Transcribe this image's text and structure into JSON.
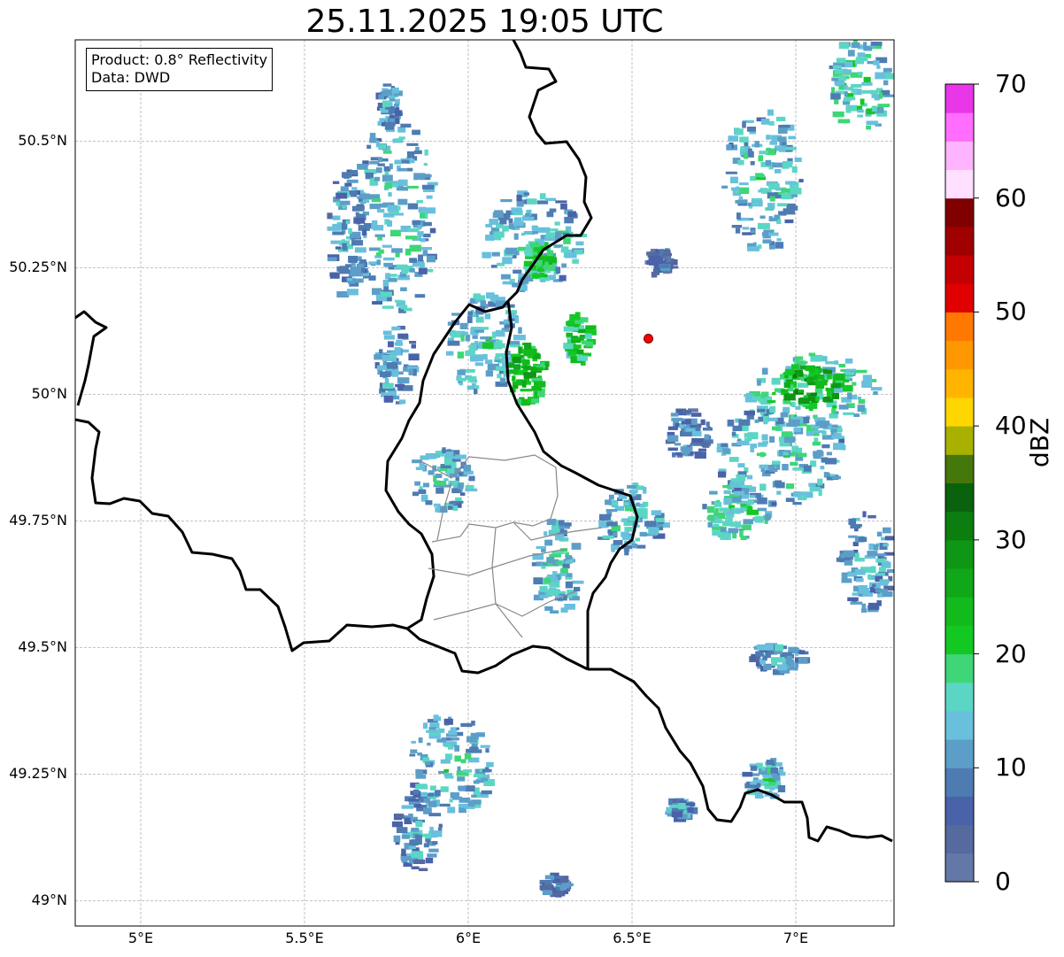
{
  "title": "25.11.2025 19:05 UTC",
  "info_box": {
    "product": "Product: 0.8° Reflectivity",
    "data": "Data: DWD"
  },
  "map_axes": {
    "lon_range": [
      4.8,
      7.3
    ],
    "lat_range": [
      48.95,
      50.7
    ],
    "x_ticks": [
      "5°E",
      "5.5°E",
      "6°E",
      "6.5°E",
      "7°E"
    ],
    "y_ticks": [
      "49°N",
      "49.25°N",
      "49.5°N",
      "49.75°N",
      "50°N",
      "50.25°N",
      "50.5°N"
    ],
    "gridlines": true
  },
  "radar_site_marker": {
    "lon": 6.55,
    "lat": 50.11,
    "color": "#ff0000"
  },
  "colorbar": {
    "label": "dBZ",
    "min": 0,
    "max": 70,
    "tick_labels": [
      "0",
      "10",
      "20",
      "30",
      "40",
      "50",
      "60",
      "70"
    ],
    "colors": [
      "#6478a8",
      "#566aa0",
      "#4a62a8",
      "#4e7bb2",
      "#5c9ec8",
      "#68c0dc",
      "#5cd6c4",
      "#3ed676",
      "#14c824",
      "#12ba1c",
      "#10a818",
      "#0e9614",
      "#0c7e10",
      "#0a620c",
      "#44780a",
      "#a8b000",
      "#ffd600",
      "#ffb400",
      "#ff9800",
      "#ff7800",
      "#e00000",
      "#c40000",
      "#a00000",
      "#800000",
      "#ffe0ff",
      "#ffb4ff",
      "#ff6eff",
      "#e836e8"
    ]
  },
  "echo_regions": [
    {
      "lon": 5.78,
      "lat": 50.35,
      "dlon": 0.12,
      "dlat": 0.2,
      "level": 6
    },
    {
      "lon": 5.63,
      "lat": 50.32,
      "dlon": 0.06,
      "dlat": 0.13,
      "level": 5
    },
    {
      "lon": 5.76,
      "lat": 50.57,
      "dlon": 0.03,
      "dlat": 0.05,
      "level": 5
    },
    {
      "lon": 6.2,
      "lat": 50.3,
      "dlon": 0.15,
      "dlat": 0.1,
      "level": 6
    },
    {
      "lon": 6.05,
      "lat": 50.1,
      "dlon": 0.12,
      "dlat": 0.1,
      "level": 6
    },
    {
      "lon": 5.78,
      "lat": 50.06,
      "dlon": 0.06,
      "dlat": 0.08,
      "level": 5
    },
    {
      "lon": 6.18,
      "lat": 50.04,
      "dlon": 0.06,
      "dlat": 0.06,
      "level": 10
    },
    {
      "lon": 6.34,
      "lat": 50.11,
      "dlon": 0.04,
      "dlat": 0.05,
      "level": 9
    },
    {
      "lon": 6.22,
      "lat": 50.26,
      "dlon": 0.04,
      "dlat": 0.04,
      "level": 9
    },
    {
      "lon": 6.9,
      "lat": 50.42,
      "dlon": 0.12,
      "dlat": 0.14,
      "level": 6
    },
    {
      "lon": 7.2,
      "lat": 50.61,
      "dlon": 0.09,
      "dlat": 0.1,
      "level": 7
    },
    {
      "lon": 7.05,
      "lat": 50.0,
      "dlon": 0.2,
      "dlat": 0.08,
      "level": 7
    },
    {
      "lon": 7.05,
      "lat": 50.02,
      "dlon": 0.1,
      "dlat": 0.04,
      "level": 11
    },
    {
      "lon": 6.95,
      "lat": 49.88,
      "dlon": 0.2,
      "dlat": 0.1,
      "level": 6
    },
    {
      "lon": 6.82,
      "lat": 49.77,
      "dlon": 0.1,
      "dlat": 0.06,
      "level": 7
    },
    {
      "lon": 7.22,
      "lat": 49.67,
      "dlon": 0.08,
      "dlat": 0.1,
      "level": 5
    },
    {
      "lon": 6.5,
      "lat": 49.75,
      "dlon": 0.1,
      "dlat": 0.07,
      "level": 6
    },
    {
      "lon": 5.92,
      "lat": 49.83,
      "dlon": 0.1,
      "dlat": 0.06,
      "level": 6
    },
    {
      "lon": 6.27,
      "lat": 49.66,
      "dlon": 0.07,
      "dlat": 0.1,
      "level": 6
    },
    {
      "lon": 6.95,
      "lat": 49.48,
      "dlon": 0.08,
      "dlat": 0.03,
      "level": 5
    },
    {
      "lon": 5.95,
      "lat": 49.27,
      "dlon": 0.13,
      "dlat": 0.1,
      "level": 6
    },
    {
      "lon": 5.85,
      "lat": 49.14,
      "dlon": 0.07,
      "dlat": 0.08,
      "level": 5
    },
    {
      "lon": 6.91,
      "lat": 49.24,
      "dlon": 0.06,
      "dlat": 0.04,
      "level": 6
    },
    {
      "lon": 6.65,
      "lat": 49.18,
      "dlon": 0.04,
      "dlat": 0.02,
      "level": 5
    },
    {
      "lon": 6.27,
      "lat": 49.03,
      "dlon": 0.04,
      "dlat": 0.02,
      "level": 4
    },
    {
      "lon": 6.59,
      "lat": 50.26,
      "dlon": 0.04,
      "dlat": 0.03,
      "level": 3
    },
    {
      "lon": 6.67,
      "lat": 49.92,
      "dlon": 0.07,
      "dlat": 0.05,
      "level": 4
    }
  ]
}
